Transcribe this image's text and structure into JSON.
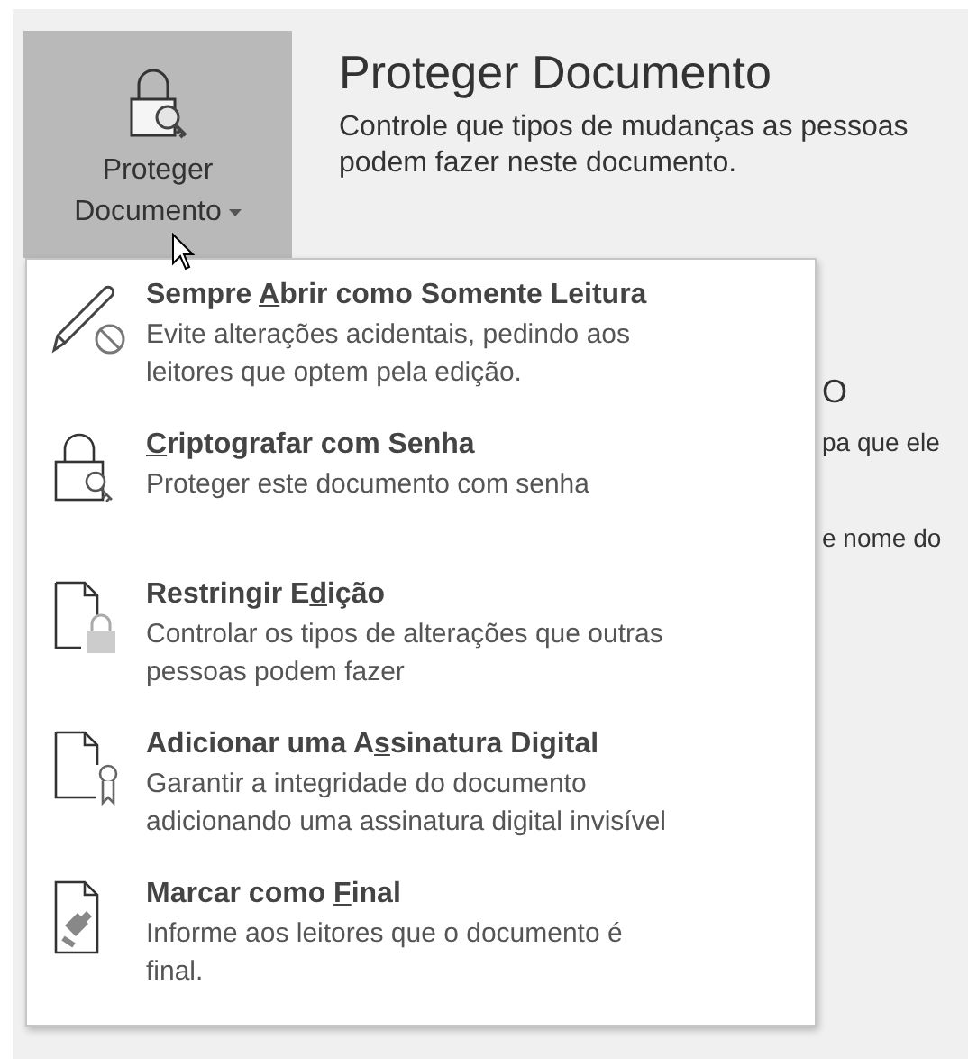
{
  "protect_button": {
    "label_lines": [
      "Proteger",
      "Documento"
    ],
    "pressed": true
  },
  "section": {
    "title": "Proteger Documento",
    "description": "Controle que tipos de mudanças as pessoas podem fazer neste documento."
  },
  "background_texts": [
    "O",
    "pa que ele",
    "e nome do"
  ],
  "menu": {
    "items": [
      {
        "kind": "read-only",
        "title_parts": [
          {
            "text": "Sempre ",
            "underlined": false
          },
          {
            "text": "A",
            "underlined": true
          },
          {
            "text": "brir como Somente Leitura",
            "underlined": false
          }
        ],
        "description": "Evite alterações acidentais, pedindo aos leitores que optem pela edição."
      },
      {
        "kind": "encrypt",
        "title_parts": [
          {
            "text": "C",
            "underlined": true
          },
          {
            "text": "riptografar com Senha",
            "underlined": false
          }
        ],
        "description": "Proteger este documento com senha"
      },
      {
        "kind": "restrict",
        "title_parts": [
          {
            "text": "Restringir E",
            "underlined": false
          },
          {
            "text": "d",
            "underlined": true
          },
          {
            "text": "ição",
            "underlined": false
          }
        ],
        "description": "Controlar os tipos de alterações que outras pessoas podem fazer"
      },
      {
        "kind": "signature",
        "title_parts": [
          {
            "text": "Adicionar uma A",
            "underlined": false
          },
          {
            "text": "s",
            "underlined": true
          },
          {
            "text": "sinatura Digital",
            "underlined": false
          }
        ],
        "description": "Garantir a integridade do documento adicionando uma assinatura digital invisível"
      },
      {
        "kind": "final",
        "title_parts": [
          {
            "text": "Marcar como ",
            "underlined": false
          },
          {
            "text": "F",
            "underlined": true
          },
          {
            "text": "inal",
            "underlined": false
          }
        ],
        "description": "Informe aos leitores que o documento é final."
      }
    ]
  }
}
